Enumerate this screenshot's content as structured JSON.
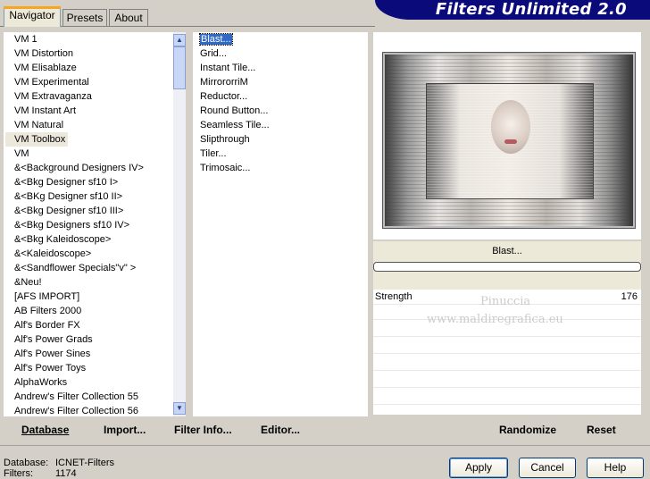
{
  "header": {
    "title": "Filters Unlimited 2.0"
  },
  "tabs": [
    {
      "label": "Navigator",
      "active": true
    },
    {
      "label": "Presets",
      "active": false
    },
    {
      "label": "About",
      "active": false
    }
  ],
  "categories": [
    "VM 1",
    "VM Distortion",
    "VM Elisablaze",
    "VM Experimental",
    "VM Extravaganza",
    "VM Instant Art",
    "VM Natural",
    "VM Toolbox",
    "VM",
    "&<Background Designers IV>",
    "&<Bkg Designer sf10 I>",
    "&<BKg Designer sf10 II>",
    "&<Bkg Designer sf10 III>",
    "&<Bkg Designers sf10 IV>",
    "&<Bkg Kaleidoscope>",
    "&<Kaleidoscope>",
    "&<Sandflower Specials\"v\" >",
    "&Neu!",
    "[AFS IMPORT]",
    "AB Filters 2000",
    "Alf's Border FX",
    "Alf's Power Grads",
    "Alf's Power Sines",
    "Alf's Power Toys",
    "AlphaWorks",
    "Andrew's Filter Collection 55",
    "Andrew's Filter Collection 56"
  ],
  "selected_category": "VM Toolbox",
  "filters": [
    "Blast...",
    "Grid...",
    "Instant Tile...",
    "MirrororriM",
    "Reductor...",
    "Round Button...",
    "Seamless Tile...",
    "Slipthrough",
    "Tiler...",
    "Trimosaic..."
  ],
  "selected_filter": "Blast...",
  "left_bar": {
    "database": "Database",
    "import": "Import...",
    "filter_info": "Filter Info...",
    "editor": "Editor..."
  },
  "preview_label": "Blast...",
  "params": [
    {
      "name": "Strength",
      "value": "176"
    }
  ],
  "watermark": {
    "line1": "Pinuccia",
    "line2": "www.maldiregrafica.eu"
  },
  "right_bar": {
    "randomize": "Randomize",
    "reset": "Reset"
  },
  "status": {
    "database_label": "Database:",
    "database_value": "ICNET-Filters",
    "filters_label": "Filters:",
    "filters_value": "1174"
  },
  "dialog": {
    "apply": "Apply",
    "cancel": "Cancel",
    "help": "Help"
  }
}
